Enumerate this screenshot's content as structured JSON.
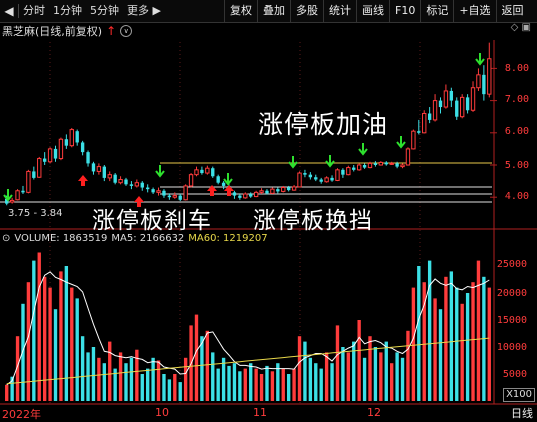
{
  "toolbar": {
    "back_glyph": "◀",
    "periods": [
      "分时",
      "1分钟",
      "5分钟",
      "更多"
    ],
    "more_arrow": "▶",
    "buttons": [
      "复权",
      "叠加",
      "多股",
      "统计",
      "画线",
      "F10",
      "标记",
      "+自选",
      "返回"
    ]
  },
  "title": {
    "text": "黑芝麻(日线,前复权)",
    "arrow_glyph": "↑",
    "dropdown_glyph": "∨",
    "right_icons": "◇  ▣"
  },
  "annotations": {
    "label_refuel": "涨停板加油",
    "label_brake": "涨停板刹车",
    "label_shift": "涨停板换挡",
    "range": "3.75 - 3.84"
  },
  "price_axis": [
    "8.00",
    "7.00",
    "6.00",
    "5.00",
    "4.00"
  ],
  "volume_header": {
    "volume": "VOLUME: 1863519",
    "ma5": "MA5: 2166632",
    "ma60": "MA60: 1219207"
  },
  "volume_axis": [
    "25000",
    "20000",
    "15000",
    "10000",
    "5000"
  ],
  "volume_unit": "X100",
  "date_axis": [
    "2022年",
    "10",
    "11",
    "12"
  ],
  "period_label": "日线",
  "colors": {
    "up": "#ff3c3c",
    "down": "#3ce0e6",
    "ma_white": "#ffffff",
    "ma_yellow": "#e8d84a",
    "arrow_green": "#2ee02e",
    "arrow_red": "#ff2020"
  },
  "chart_data": {
    "type": "candlestick",
    "candles": [
      [
        3.95,
        3.8,
        4.05,
        3.75
      ],
      [
        3.85,
        3.9,
        3.98,
        3.8
      ],
      [
        3.92,
        4.2,
        4.25,
        3.9
      ],
      [
        4.2,
        4.15,
        4.35,
        4.1
      ],
      [
        4.15,
        4.8,
        4.85,
        4.12
      ],
      [
        4.8,
        4.6,
        4.95,
        4.55
      ],
      [
        4.62,
        5.2,
        5.25,
        4.6
      ],
      [
        5.2,
        5.1,
        5.4,
        5.0
      ],
      [
        5.1,
        5.5,
        5.55,
        5.05
      ],
      [
        5.5,
        5.2,
        5.6,
        5.1
      ],
      [
        5.2,
        5.8,
        5.85,
        5.15
      ],
      [
        5.8,
        5.6,
        5.95,
        5.5
      ],
      [
        5.6,
        6.1,
        6.15,
        5.55
      ],
      [
        6.05,
        5.7,
        6.1,
        5.6
      ],
      [
        5.7,
        5.4,
        5.75,
        5.3
      ],
      [
        5.4,
        5.05,
        5.45,
        4.95
      ],
      [
        5.05,
        4.8,
        5.1,
        4.7
      ],
      [
        4.8,
        4.95,
        5.05,
        4.7
      ],
      [
        4.95,
        4.6,
        5.0,
        4.5
      ],
      [
        4.6,
        4.7,
        4.8,
        4.5
      ],
      [
        4.7,
        4.45,
        4.75,
        4.4
      ],
      [
        4.45,
        4.55,
        4.65,
        4.4
      ],
      [
        4.55,
        4.4,
        4.6,
        4.35
      ],
      [
        4.4,
        4.35,
        4.5,
        4.25
      ],
      [
        4.35,
        4.45,
        4.55,
        4.3
      ],
      [
        4.45,
        4.3,
        4.5,
        4.2
      ],
      [
        4.3,
        4.25,
        4.4,
        4.15
      ],
      [
        4.25,
        4.15,
        4.3,
        4.1
      ],
      [
        4.15,
        4.2,
        4.3,
        4.05
      ],
      [
        4.2,
        4.05,
        4.25,
        3.98
      ],
      [
        4.05,
        4.0,
        4.12,
        3.92
      ],
      [
        4.0,
        4.05,
        4.15,
        3.95
      ],
      [
        4.05,
        3.92,
        4.1,
        3.88
      ],
      [
        3.92,
        4.35,
        4.4,
        3.9
      ],
      [
        4.35,
        4.7,
        4.75,
        4.3
      ],
      [
        4.7,
        4.85,
        4.95,
        4.65
      ],
      [
        4.85,
        4.75,
        4.95,
        4.7
      ],
      [
        4.75,
        4.9,
        4.98,
        4.7
      ],
      [
        4.9,
        4.65,
        4.95,
        4.6
      ],
      [
        4.65,
        4.45,
        4.7,
        4.4
      ],
      [
        4.45,
        4.35,
        4.5,
        4.25
      ],
      [
        4.35,
        4.15,
        4.4,
        4.1
      ],
      [
        4.15,
        4.05,
        4.2,
        3.95
      ],
      [
        4.05,
        3.98,
        4.1,
        3.92
      ],
      [
        3.98,
        4.1,
        4.15,
        3.95
      ],
      [
        4.1,
        4.02,
        4.15,
        3.98
      ],
      [
        4.02,
        4.15,
        4.2,
        4.0
      ],
      [
        4.15,
        4.2,
        4.28,
        4.1
      ],
      [
        4.2,
        4.12,
        4.25,
        4.08
      ],
      [
        4.12,
        4.25,
        4.3,
        4.1
      ],
      [
        4.25,
        4.18,
        4.3,
        4.12
      ],
      [
        4.18,
        4.3,
        4.35,
        4.15
      ],
      [
        4.3,
        4.22,
        4.35,
        4.18
      ],
      [
        4.22,
        4.32,
        4.38,
        4.2
      ],
      [
        4.32,
        4.75,
        4.8,
        4.3
      ],
      [
        4.75,
        4.7,
        4.85,
        4.62
      ],
      [
        4.7,
        4.62,
        4.78,
        4.55
      ],
      [
        4.62,
        4.55,
        4.7,
        4.5
      ],
      [
        4.55,
        4.48,
        4.6,
        4.42
      ],
      [
        4.48,
        4.6,
        4.65,
        4.45
      ],
      [
        4.6,
        4.52,
        4.68,
        4.48
      ],
      [
        4.52,
        4.85,
        4.9,
        4.5
      ],
      [
        4.85,
        4.7,
        4.9,
        4.6
      ],
      [
        4.7,
        4.92,
        4.98,
        4.68
      ],
      [
        4.92,
        4.85,
        5.0,
        4.8
      ],
      [
        4.85,
        5.0,
        5.05,
        4.82
      ],
      [
        5.0,
        4.92,
        5.05,
        4.88
      ],
      [
        4.92,
        5.05,
        5.1,
        4.9
      ],
      [
        5.05,
        5.0,
        5.12,
        4.95
      ],
      [
        5.0,
        5.08,
        5.12,
        4.98
      ],
      [
        5.08,
        5.02,
        5.12,
        4.98
      ],
      [
        5.02,
        5.05,
        5.1,
        5.0
      ],
      [
        5.05,
        4.95,
        5.1,
        4.9
      ],
      [
        4.95,
        5.0,
        5.05,
        4.9
      ],
      [
        5.0,
        5.5,
        5.55,
        4.98
      ],
      [
        5.5,
        6.05,
        6.1,
        5.48
      ],
      [
        6.05,
        6.0,
        6.4,
        5.95
      ],
      [
        6.0,
        6.6,
        6.7,
        5.98
      ],
      [
        6.6,
        6.4,
        6.8,
        6.3
      ],
      [
        6.4,
        7.0,
        7.2,
        6.35
      ],
      [
        7.0,
        6.8,
        7.1,
        6.6
      ],
      [
        6.8,
        7.3,
        7.5,
        6.75
      ],
      [
        7.3,
        7.0,
        7.4,
        6.8
      ],
      [
        7.0,
        6.5,
        7.1,
        6.4
      ],
      [
        6.5,
        7.1,
        7.2,
        6.45
      ],
      [
        7.1,
        6.7,
        7.2,
        6.6
      ],
      [
        6.7,
        7.4,
        7.6,
        6.65
      ],
      [
        7.4,
        7.8,
        8.0,
        7.3
      ],
      [
        7.8,
        7.2,
        8.1,
        7.0
      ],
      [
        7.2,
        8.3,
        8.8,
        7.1
      ]
    ]
  }
}
